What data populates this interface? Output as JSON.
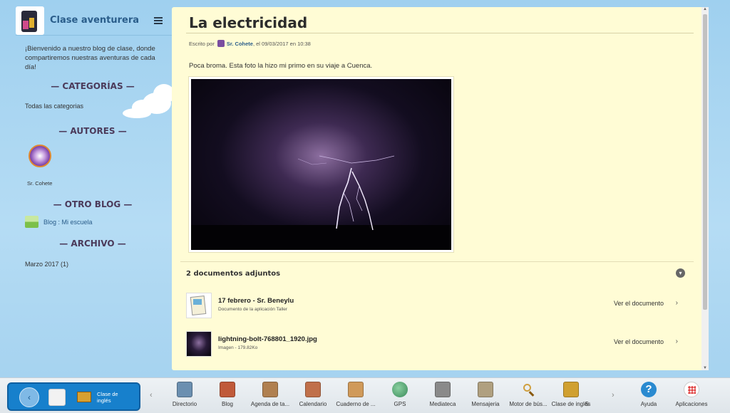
{
  "sidebar": {
    "title": "Clase aventurera",
    "welcome": "¡Bienvenido a nuestro blog de clase, donde compartiremos nuestras aventuras de cada día!",
    "sections": {
      "categories": "— CATEGORÍAS —",
      "authors": "— AUTORES —",
      "other_blog": "— OTRO BLOG —",
      "archive": "— ARCHIVO —"
    },
    "all_categories": "Todas las categorias",
    "author_name": "Sr. Cohete",
    "other_blog_link": "Blog : Mi escuela",
    "archive_item": "Marzo 2017 (1)"
  },
  "post": {
    "title": "La electricidad",
    "written_by": "Escrito por",
    "author": "Sr. Cohete",
    "date": ", el 09/03/2017 en 10:38",
    "body": "Poca broma. Esta foto la hizo mi primo en su viaje a Cuenca."
  },
  "attachments": {
    "header": "2 documentos adjuntos",
    "items": [
      {
        "name": "17 febrero - Sr. Beneylu",
        "sub": "Documento de la aplicación Taller",
        "link": "Ver el documento",
        "icon": "document-icon"
      },
      {
        "name": "lightning-bolt-768801_1920.jpg",
        "sub": "Imagen - 179.82Ko",
        "link": "Ver el documento",
        "icon": "image-thumbnail"
      }
    ]
  },
  "dock": {
    "left_label_line1": "Clase de",
    "left_label_line2": "inglés",
    "items": [
      {
        "label": "Directorio",
        "icon": "directory-icon",
        "color": "#6b8fb0"
      },
      {
        "label": "Blog",
        "icon": "blog-icon",
        "color": "#c05a3a"
      },
      {
        "label": "Agenda de ta...",
        "icon": "agenda-icon",
        "color": "#b08050"
      },
      {
        "label": "Calendario",
        "icon": "calendar-icon",
        "color": "#c0704a"
      },
      {
        "label": "Cuaderno de ...",
        "icon": "notebook-icon",
        "color": "#d09a5a"
      },
      {
        "label": "GPS",
        "icon": "globe-icon",
        "color": "#3a8a5a"
      },
      {
        "label": "Mediateca",
        "icon": "media-icon",
        "color": "#8a8a8a"
      },
      {
        "label": "Mensajeria",
        "icon": "mail-icon",
        "color": "#b0a080"
      },
      {
        "label": "Motor de bús...",
        "icon": "search-icon",
        "color": "#d0a040"
      },
      {
        "label": "Clase de inglés",
        "icon": "english-class-icon",
        "color": "#d0a030"
      },
      {
        "label": "S",
        "icon": "partial-icon",
        "color": "#aaaaaa"
      },
      {
        "label": "Ayuda",
        "icon": "help-icon",
        "color": "#2a8ad0"
      },
      {
        "label": "Aplicaciones",
        "icon": "apps-grid-icon",
        "color": "#666666"
      }
    ]
  }
}
